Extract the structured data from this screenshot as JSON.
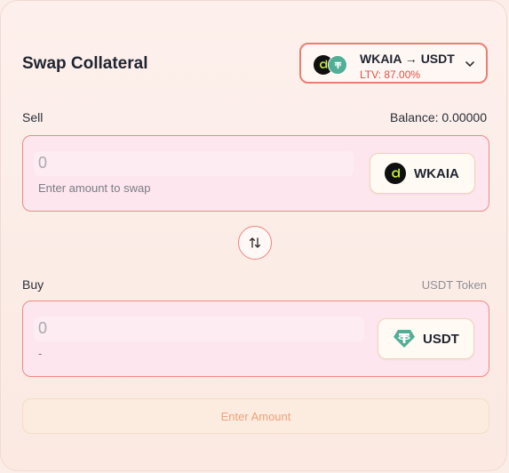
{
  "header": {
    "title": "Swap Collateral",
    "pair": {
      "text": "WKAIA → USDT",
      "ltv": "LTV: 87.00%"
    }
  },
  "sell": {
    "label": "Sell",
    "balance": "Balance: 0.00000",
    "amount_value": "0",
    "hint": "Enter amount to swap",
    "token": "WKAIA"
  },
  "buy": {
    "label": "Buy",
    "token_caption": "USDT Token",
    "amount_value": "0",
    "hint": "-",
    "token": "USDT"
  },
  "submit": {
    "label": "Enter Amount"
  },
  "icons": {
    "kaia": "kaia-logo-icon",
    "usdt": "tether-logo-icon",
    "chevron": "chevron-down-icon",
    "swap": "swap-arrows-icon"
  },
  "colors": {
    "accent": "#ef7c73",
    "ltv": "#e05046",
    "usdt": "#50af95",
    "panel_bg": "#fde6ee"
  }
}
